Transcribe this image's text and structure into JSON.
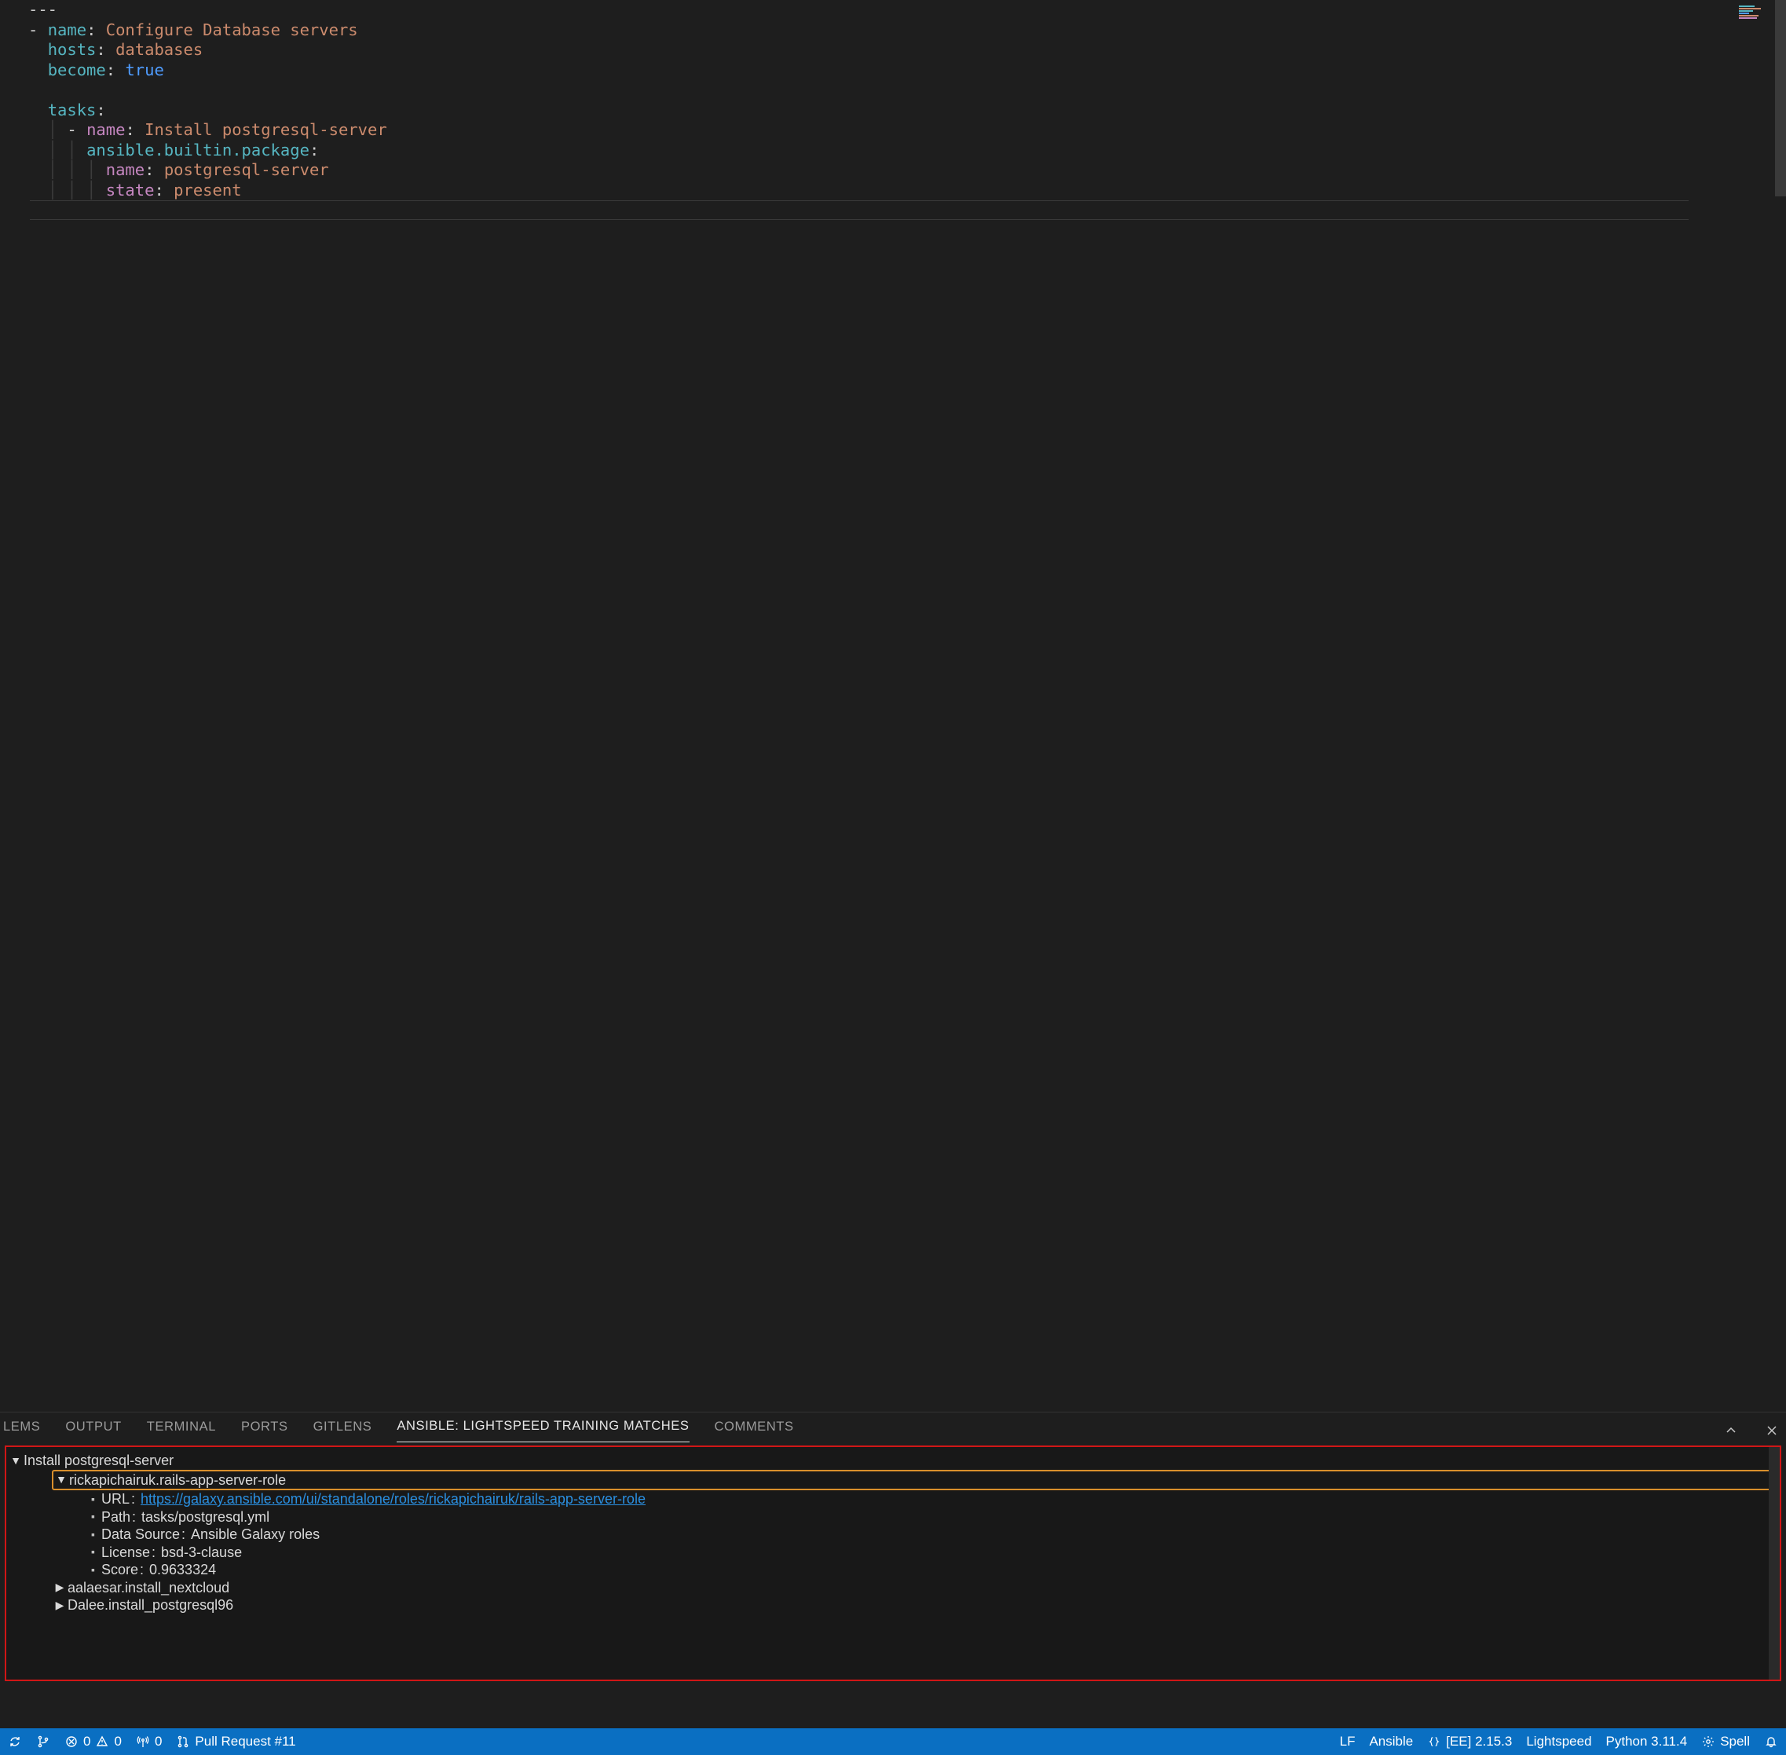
{
  "editor": {
    "lines": {
      "l1": "---",
      "l2_dash": "-",
      "l2_key": "name",
      "l2_val": "Configure Database servers",
      "l3_key": "hosts",
      "l3_val": "databases",
      "l4_key": "become",
      "l4_val": "true",
      "l6_key": "tasks",
      "l7_dash": "-",
      "l7_key": "name",
      "l7_val": "Install postgresql-server",
      "l8_key": "ansible.builtin.package",
      "l9_key": "name",
      "l9_val": "postgresql-server",
      "l10_key": "state",
      "l10_val": "present"
    }
  },
  "panel": {
    "tabs": [
      "LEMS",
      "OUTPUT",
      "TERMINAL",
      "PORTS",
      "GITLENS",
      "ANSIBLE: LIGHTSPEED TRAINING MATCHES",
      "COMMENTS"
    ],
    "active_tab": 5,
    "tree": {
      "root": {
        "label": "Install postgresql-server",
        "children": [
          {
            "label": "rickapichairuk.rails-app-server-role",
            "expanded": true,
            "highlighted": true,
            "details": [
              {
                "label": "URL",
                "value": "https://galaxy.ansible.com/ui/standalone/roles/rickapichairuk/rails-app-server-role",
                "link": true
              },
              {
                "label": "Path",
                "value": "tasks/postgresql.yml"
              },
              {
                "label": "Data Source",
                "value": "Ansible Galaxy roles"
              },
              {
                "label": "License",
                "value": "bsd-3-clause"
              },
              {
                "label": "Score",
                "value": "0.9633324"
              }
            ]
          },
          {
            "label": "aalaesar.install_nextcloud",
            "expanded": false
          },
          {
            "label": "Dalee.install_postgresql96",
            "expanded": false
          }
        ]
      }
    }
  },
  "statusbar": {
    "errors": "0",
    "warnings": "0",
    "ports": "0",
    "pr": "Pull Request #11",
    "eol": "LF",
    "lang": "Ansible",
    "ee": "[EE] 2.15.3",
    "lightspeed": "Lightspeed",
    "python": "Python 3.11.4",
    "spell": "Spell"
  }
}
